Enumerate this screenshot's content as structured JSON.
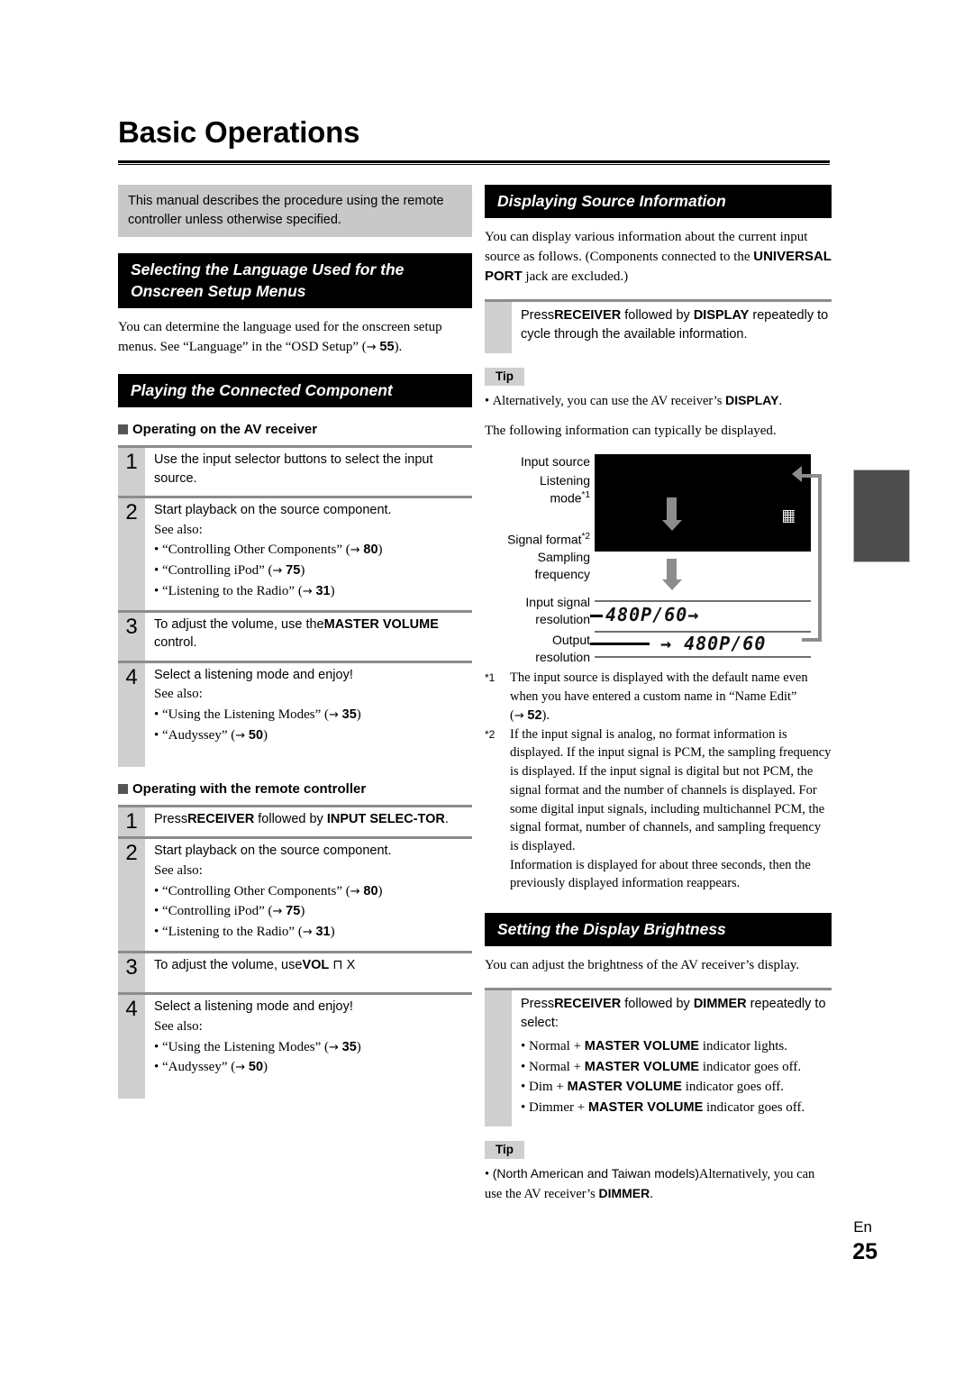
{
  "document": {
    "title": "Basic Operations",
    "footer_language": "En",
    "footer_page": "25"
  },
  "left_column": {
    "intro_note": "This manual describes the procedure using the remote controller unless otherwise specified.",
    "section_language": {
      "heading": "Selecting the Language Used for the Onscreen Setup Menus",
      "body_1": "You can determine the language used for the onscreen setup menus. See “Language” in the “OSD Setup”",
      "body_ref_open": "(",
      "body_ref_arrow": "→",
      "body_ref_page": "55",
      "body_ref_close": ")."
    },
    "section_playing": {
      "heading": "Playing the Connected Component",
      "sub_receiver": "Operating on the AV receiver",
      "sub_remote": "Operating with the remote controller",
      "receiver_steps": [
        {
          "num": "1",
          "lead_plain_1": "Use the input selector buttons to select the input source.",
          "see_also": "",
          "refs": []
        },
        {
          "num": "2",
          "lead_plain_1": "Start playback on the source component.",
          "see_also": "See also:",
          "refs": [
            {
              "text": "“Controlling Other Components”",
              "arrow": "→",
              "page": "80"
            },
            {
              "text": "“Controlling iPod”",
              "arrow": "→",
              "page": "75"
            },
            {
              "text": "“Listening to the Radio”",
              "arrow": "→",
              "page": "31"
            }
          ]
        },
        {
          "num": "3",
          "lead_plain_1": "To adjust the volume, use the",
          "lead_bold": "MASTER VOLUME",
          "lead_plain_2": "control.",
          "see_also": "",
          "refs": []
        },
        {
          "num": "4",
          "lead_plain_1": "Select a listening mode and enjoy!",
          "see_also": "See also:",
          "refs": [
            {
              "text": "“Using the Listening Modes”",
              "arrow": "→",
              "page": "35"
            },
            {
              "text": "“Audyssey”",
              "arrow": "→",
              "page": "50"
            }
          ]
        }
      ],
      "remote_steps": [
        {
          "num": "1",
          "lead_plain_1": "Press",
          "lead_bold": "RECEIVER",
          "lead_plain_2": "followed by",
          "lead_bold_2": "INPUT SELEC-TOR",
          "lead_plain_3": ".",
          "see_also": "",
          "refs": []
        },
        {
          "num": "2",
          "lead_plain_1": "Start playback on the source component.",
          "see_also": "See also:",
          "refs": [
            {
              "text": "“Controlling Other Components”",
              "arrow": "→",
              "page": "80"
            },
            {
              "text": "“Controlling iPod”",
              "arrow": "→",
              "page": "75"
            },
            {
              "text": "“Listening to the Radio”",
              "arrow": "→",
              "page": "31"
            }
          ]
        },
        {
          "num": "3",
          "lead_plain_1": "To adjust the volume, use",
          "lead_bold": "VOL",
          "lead_plain_2": "⊓ X",
          "see_also": "",
          "refs": []
        },
        {
          "num": "4",
          "lead_plain_1": "Select a listening mode and enjoy!",
          "see_also": "See also:",
          "refs": [
            {
              "text": "“Using the Listening Modes”",
              "arrow": "→",
              "page": "35"
            },
            {
              "text": "“Audyssey”",
              "arrow": "→",
              "page": "50"
            }
          ]
        }
      ]
    }
  },
  "right_column": {
    "section_source_info": {
      "heading": "Displaying Source Information",
      "body_1": "You can display various information about the current input source as follows. (Components connected to the",
      "body_bold": "UNIVERSAL PORT",
      "body_2": "jack are excluded.)",
      "instruction": {
        "plain_1": "Press",
        "bold_1": "RECEIVER",
        "plain_2": "followed by",
        "bold_2": "DISPLAY",
        "plain_3": "repeatedly to cycle through the available information."
      },
      "tip_label": "Tip",
      "tip_text_1": "Alternatively, you can use the AV receiver’s",
      "tip_bold_1": "DISPLAY",
      "tip_text_2": ".",
      "lead_in": "The following information can typically be displayed.",
      "diagram": {
        "labels": [
          "Input source",
          "Listening mode*1",
          "Signal format*2",
          "Sampling frequency",
          "Input signal resolution",
          "Output resolution"
        ],
        "label_input_source": "Input source",
        "label_listening_mode": "Listening",
        "label_listening_mode_2": "mode",
        "label_listening_mode_sup": "*1",
        "label_signal_format": "Signal format",
        "label_signal_format_sup": "*2",
        "label_sampling": "Sampling",
        "label_frequency": "frequency",
        "label_input_signal": "Input signal",
        "label_input_resolution": "resolution",
        "label_output": "Output",
        "label_output_resolution": "resolution",
        "lcd_input_value": "480P/60",
        "lcd_input_arrow": "→",
        "lcd_output_arrow": "→",
        "lcd_output_value": "480P/60"
      },
      "footnotes": [
        {
          "mark": "*1",
          "text_1": "The input source is displayed with the default name even when you have entered a custom name in “Name Edit” (",
          "arrow": "→",
          "page": "52",
          "text_2": ")."
        },
        {
          "mark": "*2",
          "text_1": "If the input signal is analog, no format information is displayed. If the input signal is PCM, the sampling frequency is displayed. If the input signal is digital but not PCM, the signal format and the number of channels is displayed. For some digital input signals, including multichannel PCM, the signal format, number of channels, and sampling frequency is displayed.",
          "text_2": "Information is displayed for about three seconds, then the previously displayed information reappears."
        }
      ]
    },
    "section_brightness": {
      "heading": "Setting the Display Brightness",
      "body_1": "You can adjust the brightness of the AV receiver’s display.",
      "instruction": {
        "plain_1": "Press",
        "bold_1": "RECEIVER",
        "plain_2": "followed by",
        "bold_2": "DIMMER",
        "plain_3": "repeatedly to select:"
      },
      "options": [
        {
          "prefix": "Normal + ",
          "bold": "MASTER VOLUME",
          "suffix": " indicator lights."
        },
        {
          "prefix": "Normal + ",
          "bold": "MASTER VOLUME",
          "suffix": " indicator goes off."
        },
        {
          "prefix": "Dim + ",
          "bold": "MASTER VOLUME",
          "suffix": " indicator goes off."
        },
        {
          "prefix": "Dimmer + ",
          "bold": "MASTER VOLUME",
          "suffix": " indicator goes off."
        }
      ],
      "tip_label": "Tip",
      "tip_models": "(North American and Taiwan models)",
      "tip_text_1": "Alternatively, you can use the AV receiver’s",
      "tip_bold_1": "DIMMER",
      "tip_text_2": "."
    }
  },
  "colors": {
    "heading_bg": "#000000",
    "note_bg": "#c8c8c8",
    "rail_bg": "#cfcfcf",
    "rule": "#8c8c8c",
    "edge_tab": "#4d4d4d"
  }
}
